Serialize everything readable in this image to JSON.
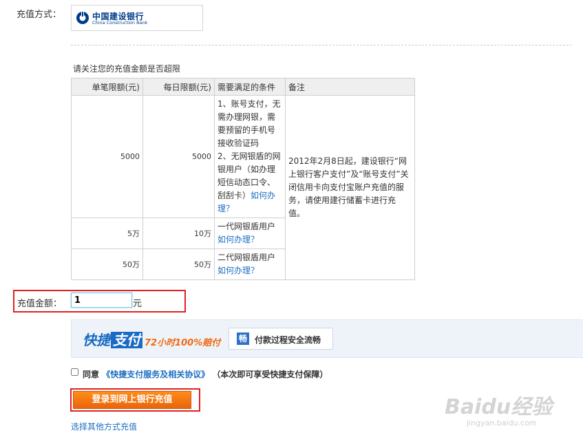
{
  "payment_method": {
    "label": "充值方式：",
    "bank_name_cn": "中国建设银行",
    "bank_name_en": "China Construction Bank"
  },
  "limit_note": "请关注您的充值金额是否超限",
  "limits_table": {
    "headers": [
      "单笔限额(元)",
      "每日限额(元)",
      "需要满足的条件",
      "备注"
    ],
    "rows": [
      {
        "single": "5000",
        "daily": "5000",
        "condition_1": "1、账号支付，无需办理网银，需要预留的手机号接收验证码",
        "condition_2": "2、无网银盾的网银用户（如办理短信动态口令、刮刮卡）",
        "link": "如何办理？"
      },
      {
        "single": "5万",
        "daily": "10万",
        "condition": "一代网银盾用户",
        "link": "如何办理？"
      },
      {
        "single": "50万",
        "daily": "50万",
        "condition": "二代网银盾用户",
        "link": "如何办理？"
      }
    ],
    "remark": "2012年2月8日起，建设银行“网上银行客户支付”及“账号支付”关闭信用卡向支付宝账户充值的服务，请使用建行储蓄卡进行充值。"
  },
  "amount": {
    "label": "充值金额：",
    "value": "1",
    "unit": "元"
  },
  "quick_pay_banner": {
    "logo_prefix": "快捷",
    "logo_highlight": "支付",
    "slogan": "72小时100%赔付",
    "badge_icon_char": "畅",
    "badge_text": "付款过程安全流畅"
  },
  "agreement": {
    "checked": false,
    "prefix": "同意",
    "link": "《快捷支付服务及相关协议》",
    "suffix": "（本次即可享受快捷支付保障）"
  },
  "login_button": "登录到网上银行充值",
  "other_methods_link": "选择其他方式充值",
  "watermark": {
    "text": "Baidu经验",
    "url": "jingyan.baidu.com"
  },
  "colors": {
    "link": "#1b6ec2",
    "highlight_border": "#e02020",
    "button_orange": "#f07a12",
    "bank_blue": "#003b8a"
  }
}
